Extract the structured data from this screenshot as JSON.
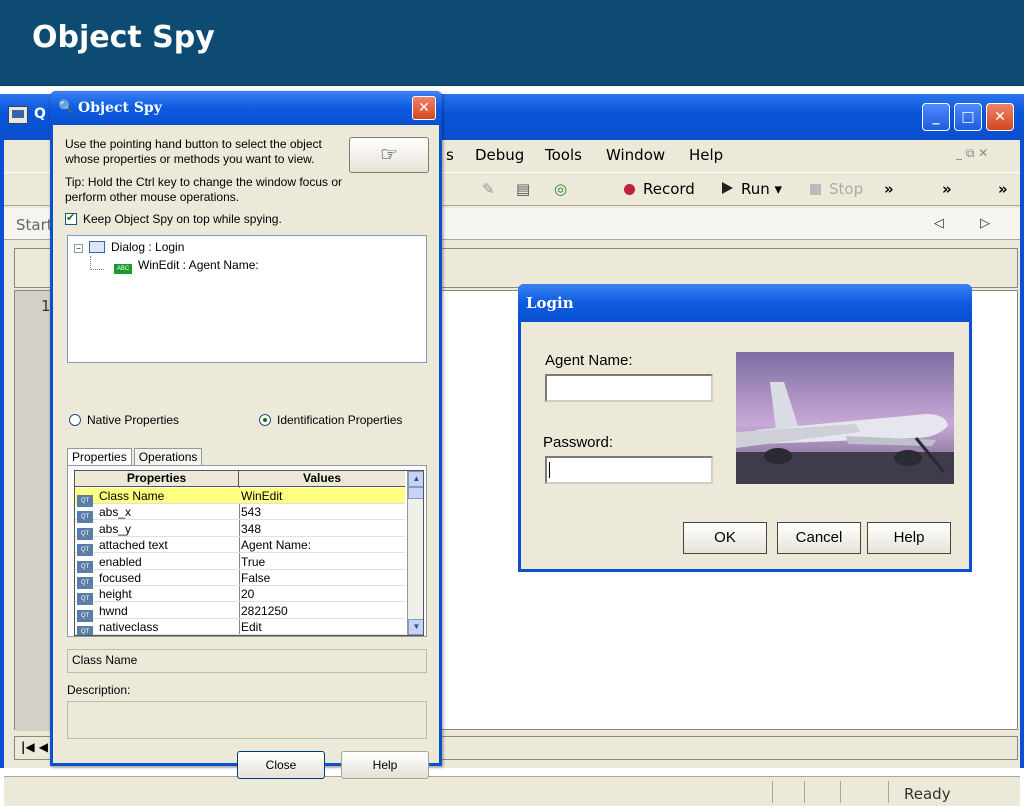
{
  "slide": {
    "title": "Object Spy"
  },
  "main_window": {
    "title": "Q",
    "menu": [
      {
        "label": "s"
      },
      {
        "label": "Debug"
      },
      {
        "label": "Tools"
      },
      {
        "label": "Window"
      },
      {
        "label": "Help"
      }
    ],
    "toolbar": {
      "record_label": "Record",
      "run_label": "Run",
      "stop_label": "Stop",
      "more1": "»",
      "more2": "»",
      "more3": "»"
    },
    "start_tab": "Start",
    "editor_line": "1:",
    "status": "Ready",
    "nav_arrows": "◁ ▷",
    "window_min": "_",
    "window_max": "□",
    "window_close": "✕"
  },
  "object_spy": {
    "title": "Object Spy",
    "instructions": "Use the pointing hand button to select the object whose properties or methods you want to view.",
    "tip": "Tip: Hold the Ctrl key to change the window focus or perform other mouse operations.",
    "keep_on_top_label": "Keep Object Spy on top while spying.",
    "keep_on_top_checked": true,
    "tree": {
      "root": "Dialog : Login",
      "child": "WinEdit : Agent Name:"
    },
    "radio_native": "Native Properties",
    "radio_identification": "Identification Properties",
    "selected_radio": "identification",
    "tabs": [
      "Properties",
      "Operations"
    ],
    "active_tab": "Properties",
    "grid_headers": {
      "properties": "Properties",
      "values": "Values"
    },
    "rows": [
      {
        "property": "Class Name",
        "value": "WinEdit"
      },
      {
        "property": "abs_x",
        "value": "543"
      },
      {
        "property": "abs_y",
        "value": "348"
      },
      {
        "property": "attached text",
        "value": "Agent Name:"
      },
      {
        "property": "enabled",
        "value": "True"
      },
      {
        "property": "focused",
        "value": "False"
      },
      {
        "property": "height",
        "value": "20"
      },
      {
        "property": "hwnd",
        "value": "2821250"
      },
      {
        "property": "nativeclass",
        "value": "Edit"
      }
    ],
    "selected_row": 0,
    "selected_property_display": "Class Name",
    "description_label": "Description:",
    "description_value": "",
    "close_button": "Close",
    "help_button": "Help",
    "hand_button": "☞"
  },
  "login_dialog": {
    "title": "Login",
    "agent_name_label": "Agent Name:",
    "agent_name_value": "",
    "password_label": "Password:",
    "password_value": "",
    "ok_button": "OK",
    "cancel_button": "Cancel",
    "help_button": "Help"
  },
  "colors": {
    "slide_header": "#0d4b73",
    "xp_title_blue": "#0a56d8",
    "xp_face": "#ece9d8",
    "selected_row": "#ffff80",
    "record_dot": "#c0203a"
  }
}
